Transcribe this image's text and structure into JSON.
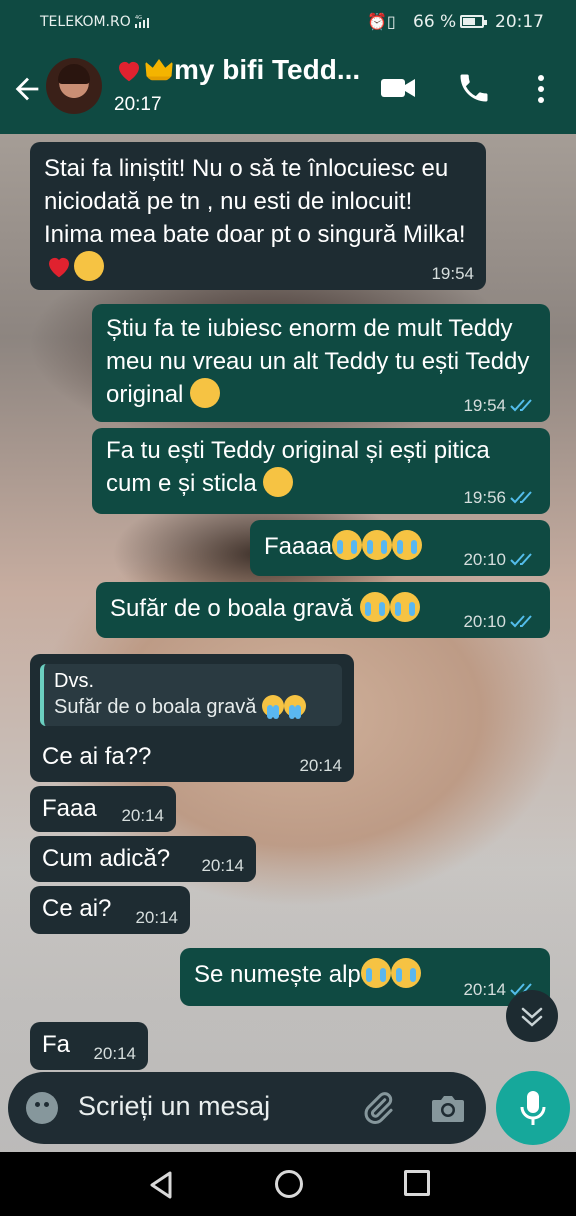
{
  "status_bar": {
    "carrier": "TELEKOM.RO",
    "network": "4G",
    "battery": "66 %",
    "battery_level": 0.66,
    "time": "20:17"
  },
  "header": {
    "contact_name": "my bifi Tedd...",
    "name_emoji": [
      "red-heart",
      "crown"
    ],
    "last_seen": "20:17"
  },
  "messages": [
    {
      "direction": "in",
      "text": "Stai fa liniștit! Nu o să te înlocuiesc eu niciodată pe tn , nu esti  de inlocuit! Inima mea bate doar pt o singură Milka!",
      "emoji": [
        "red-heart",
        "smiling-face-with-hearts"
      ],
      "time": "19:54"
    },
    {
      "direction": "out",
      "text": "Știu fa te iubiesc enorm de mult Teddy meu nu vreau un alt Teddy tu ești Teddy original",
      "emoji": [
        "pleading-face"
      ],
      "time": "19:54",
      "status": "read"
    },
    {
      "direction": "out",
      "text": "Fa tu ești Teddy original și ești pitica cum e și sticla",
      "emoji": [
        "laughing-face"
      ],
      "time": "19:56",
      "status": "read"
    },
    {
      "direction": "out",
      "text": "Faaaa",
      "emoji": [
        "loudly-crying-face",
        "loudly-crying-face",
        "loudly-crying-face"
      ],
      "time": "20:10",
      "status": "read"
    },
    {
      "direction": "out",
      "text": "Sufăr de o boala gravă",
      "emoji": [
        "loudly-crying-face",
        "loudly-crying-face"
      ],
      "time": "20:10",
      "status": "read"
    },
    {
      "direction": "in",
      "reply": {
        "author": "Dvs.",
        "text": "Sufăr de o boala gravă"
      },
      "text": "Ce ai fa??",
      "time": "20:14"
    },
    {
      "direction": "in",
      "text": "Faaa",
      "time": "20:14"
    },
    {
      "direction": "in",
      "text": "Cum adică?",
      "time": "20:14"
    },
    {
      "direction": "in",
      "text": "Ce ai?",
      "time": "20:14"
    },
    {
      "direction": "out",
      "text": "Se numește alp",
      "emoji": [
        "loudly-crying-face",
        "loudly-crying-face"
      ],
      "time": "20:14",
      "status": "read"
    },
    {
      "direction": "in",
      "text": "Fa",
      "time": "20:14"
    }
  ],
  "composer": {
    "placeholder": "Scrieți un mesaj"
  },
  "colors": {
    "header_bg": "#0f4a42",
    "incoming_bubble": "#1e2c32",
    "outgoing_bubble": "#0f4a42",
    "read_ticks": "#53bdeb",
    "mic_button": "#16a89b"
  },
  "icons": [
    "back-arrow-icon",
    "video-call-icon",
    "phone-icon",
    "more-vert-icon",
    "emoji-icon",
    "attach-icon",
    "camera-icon",
    "mic-icon",
    "scroll-down-icon",
    "nav-back-icon",
    "nav-home-icon",
    "nav-recent-icon"
  ]
}
